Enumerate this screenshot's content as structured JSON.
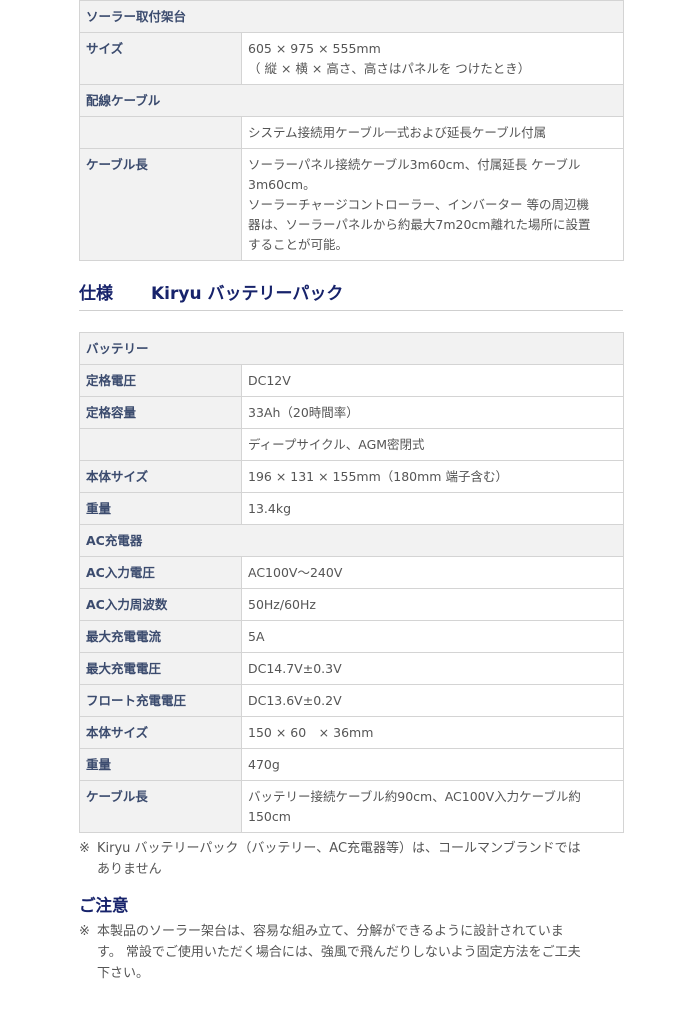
{
  "solar_table": {
    "rows": [
      {
        "type": "section",
        "label": "ソーラー取付架台"
      },
      {
        "type": "row",
        "key": "サイズ",
        "lines": [
          "605 × 975 × 555mm",
          "（ 縦 × 横 × 高さ、高さはパネルを つけたとき）"
        ]
      },
      {
        "type": "section",
        "label": "配線ケーブル"
      },
      {
        "type": "row",
        "key": "",
        "lines": [
          "システム接続用ケーブル一式および延長ケーブル付属"
        ]
      },
      {
        "type": "row",
        "key": "ケーブル長",
        "lines": [
          "ソーラーパネル接続ケーブル3m60cm、付属延長 ケーブル",
          "3m60cm。",
          "ソーラーチャージコントローラー、インバーター 等の周辺機",
          "器は、ソーラーパネルから約最大7m20cm離れた場所に設置",
          "することが可能。"
        ]
      }
    ]
  },
  "heading": {
    "prefix": "仕様",
    "title": "Kiryu バッテリーパック"
  },
  "battery_table": {
    "rows": [
      {
        "type": "section",
        "label": "バッテリー"
      },
      {
        "type": "row",
        "key": "定格電圧",
        "lines": [
          "DC12V"
        ]
      },
      {
        "type": "row",
        "key": "定格容量",
        "lines": [
          "33Ah（20時間率）"
        ]
      },
      {
        "type": "row",
        "key": "",
        "lines": [
          "ディープサイクル、AGM密閉式"
        ]
      },
      {
        "type": "row",
        "key": "本体サイズ",
        "lines": [
          "196 × 131 × 155mm（180mm 端子含む）"
        ]
      },
      {
        "type": "row",
        "key": "重量",
        "lines": [
          "13.4kg"
        ]
      },
      {
        "type": "section",
        "label": "AC充電器"
      },
      {
        "type": "row",
        "key": "AC入力電圧",
        "lines": [
          "AC100V～240V"
        ]
      },
      {
        "type": "row",
        "key": "AC入力周波数",
        "lines": [
          "50Hz/60Hz"
        ]
      },
      {
        "type": "row",
        "key": "最大充電電流",
        "lines": [
          "5A"
        ]
      },
      {
        "type": "row",
        "key": "最大充電電圧",
        "lines": [
          "DC14.7V±0.3V"
        ]
      },
      {
        "type": "row",
        "key": "フロート充電電圧",
        "lines": [
          "DC13.6V±0.2V"
        ]
      },
      {
        "type": "row",
        "key": "本体サイズ",
        "lines": [
          "150 × 60　× 36mm"
        ]
      },
      {
        "type": "row",
        "key": "重量",
        "lines": [
          "470g"
        ]
      },
      {
        "type": "row",
        "key": "ケーブル長",
        "lines": [
          "バッテリー接続ケーブル約90cm、AC100V入力ケーブル約",
          "150cm"
        ]
      }
    ]
  },
  "note": {
    "mark": "※",
    "lines": [
      "Kiryu バッテリーパック（バッテリー、AC充電器等）は、コールマンブランドでは",
      "ありません"
    ]
  },
  "caution": {
    "title": "ご注意",
    "mark": "※",
    "lines": [
      "本製品のソーラー架台は、容易な組み立て、分解ができるように設計されていま",
      "す。 常設でご使用いただく場合には、強風で飛んだりしないよう固定方法をご工夫",
      "下さい。"
    ]
  }
}
